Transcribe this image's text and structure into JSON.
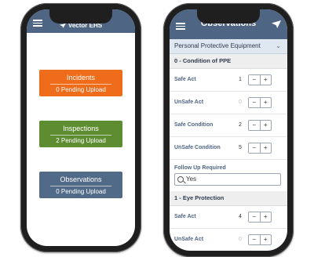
{
  "left_phone": {
    "app_title": "Vector EHS",
    "tiles": [
      {
        "title": "Incidents",
        "subtitle": "0 Pending Upload",
        "color": "#ef6c1a"
      },
      {
        "title": "Inspections",
        "subtitle": "2 Pending Upload",
        "color": "#5e8c31"
      },
      {
        "title": "Observations",
        "subtitle": "0 Pending Upload",
        "color": "#516a87"
      }
    ]
  },
  "right_phone": {
    "screen_title": "Observations",
    "category": "Personal Protective Equipment",
    "sections": [
      {
        "title": "0 - Condition of PPE",
        "rows": [
          {
            "label": "Safe Act",
            "value": "1"
          },
          {
            "label": "UnSafe Act",
            "value": "0"
          },
          {
            "label": "Safe Condition",
            "value": "2"
          },
          {
            "label": "UnSafe Condition",
            "value": "5"
          }
        ],
        "follow_up_label": "Follow Up Required",
        "follow_up_value": "Yes"
      },
      {
        "title": "1 - Eye Protection",
        "rows": [
          {
            "label": "Safe Act",
            "value": "4"
          },
          {
            "label": "UnSafe Act",
            "value": "0"
          }
        ]
      }
    ],
    "stepper_minus": "−",
    "stepper_plus": "+"
  }
}
